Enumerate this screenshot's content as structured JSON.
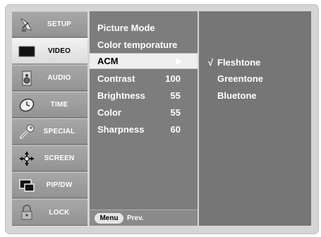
{
  "sidebar": {
    "items": [
      {
        "label": "SETUP",
        "icon": "satellite-dish-icon",
        "active": false
      },
      {
        "label": "VIDEO",
        "icon": "tv-screen-icon",
        "active": true
      },
      {
        "label": "AUDIO",
        "icon": "speaker-icon",
        "active": false
      },
      {
        "label": "TIME",
        "icon": "clock-icon",
        "active": false
      },
      {
        "label": "SPECIAL",
        "icon": "wrench-icon",
        "active": false
      },
      {
        "label": "SCREEN",
        "icon": "cross-arrows-icon",
        "active": false
      },
      {
        "label": "PIP/DW",
        "icon": "pip-windows-icon",
        "active": false
      },
      {
        "label": "LOCK",
        "icon": "padlock-icon",
        "active": false
      }
    ]
  },
  "video_menu": {
    "items": [
      {
        "label": "Picture Mode",
        "value": ""
      },
      {
        "label": "Color temporature",
        "value": ""
      },
      {
        "label": "ACM",
        "value": "",
        "arrow": "▶",
        "selected": true
      },
      {
        "label": "Contrast",
        "value": "100"
      },
      {
        "label": "Brightness",
        "value": "55"
      },
      {
        "label": "Color",
        "value": "55"
      },
      {
        "label": "Sharpness",
        "value": "60"
      }
    ]
  },
  "acm_submenu": {
    "options": [
      {
        "label": "Fleshtone",
        "checked": true,
        "check_mark": "√"
      },
      {
        "label": "Greentone",
        "checked": false,
        "check_mark": ""
      },
      {
        "label": "Bluetone",
        "checked": false,
        "check_mark": ""
      }
    ]
  },
  "footer": {
    "menu_button": "Menu",
    "prev_label": "Prev."
  },
  "colors": {
    "frame": "#d5d5d5",
    "sidebar": "#9e9e9e",
    "panel": "#7d7d7d",
    "submenu": "#767676",
    "highlight": "#eeeeee"
  }
}
